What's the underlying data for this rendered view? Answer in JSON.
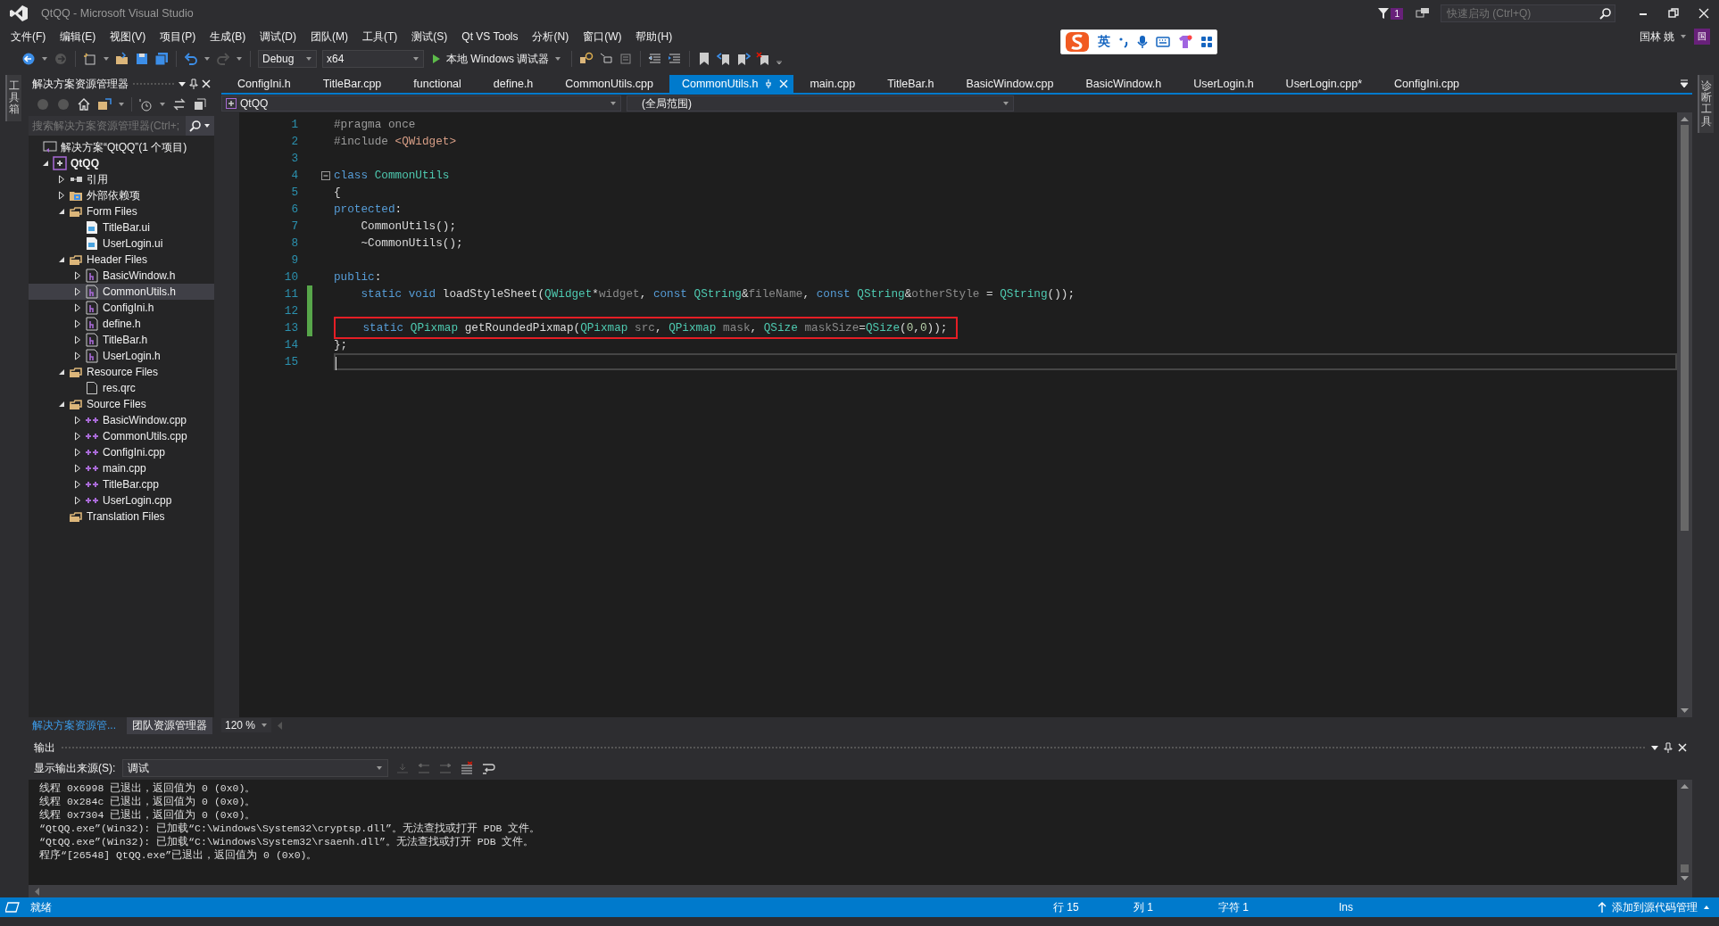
{
  "window": {
    "title": "QtQQ - Microsoft Visual Studio"
  },
  "title_bar": {
    "notification_count": "1",
    "quick_launch": {
      "placeholder": "快速启动 (Ctrl+Q)"
    }
  },
  "menu": [
    "文件(F)",
    "编辑(E)",
    "视图(V)",
    "项目(P)",
    "生成(B)",
    "调试(D)",
    "团队(M)",
    "工具(T)",
    "测试(S)",
    "Qt VS Tools",
    "分析(N)",
    "窗口(W)",
    "帮助(H)"
  ],
  "account": {
    "name": "国林 姚",
    "avatar": "国"
  },
  "ime_bar": {
    "mode": "英"
  },
  "toolbar": {
    "configuration": "Debug",
    "platform": "x64",
    "debugger": "本地 Windows 调试器"
  },
  "side_panels": {
    "left": "工具箱",
    "right": "诊断工具"
  },
  "solution_explorer": {
    "title": "解决方案资源管理器",
    "search": {
      "placeholder": "搜索解决方案资源管理器(Ctrl+;"
    },
    "tree": [
      {
        "label": "解决方案“QtQQ”(1 个项目)",
        "kind": "solution",
        "selected": false,
        "children": [
          {
            "label": "QtQQ",
            "kind": "project",
            "expanded": true,
            "selected": false,
            "children": [
              {
                "label": "引用",
                "kind": "references",
                "expanded": false,
                "selected": false
              },
              {
                "label": "外部依赖项",
                "kind": "external",
                "expanded": false,
                "selected": false
              },
              {
                "label": "Form Files",
                "kind": "folder",
                "expanded": true,
                "selected": false,
                "children": [
                  {
                    "label": "TitleBar.ui",
                    "kind": "ui",
                    "selected": false
                  },
                  {
                    "label": "UserLogin.ui",
                    "kind": "ui",
                    "selected": false
                  }
                ]
              },
              {
                "label": "Header Files",
                "kind": "folder",
                "expanded": true,
                "selected": false,
                "children": [
                  {
                    "label": "BasicWindow.h",
                    "kind": "header",
                    "expanded": false,
                    "selected": false
                  },
                  {
                    "label": "CommonUtils.h",
                    "kind": "header",
                    "expanded": false,
                    "selected": true
                  },
                  {
                    "label": "ConfigIni.h",
                    "kind": "header",
                    "expanded": false,
                    "selected": false
                  },
                  {
                    "label": "define.h",
                    "kind": "header",
                    "expanded": false,
                    "selected": false
                  },
                  {
                    "label": "TitleBar.h",
                    "kind": "header",
                    "expanded": false,
                    "selected": false
                  },
                  {
                    "label": "UserLogin.h",
                    "kind": "header",
                    "expanded": false,
                    "selected": false
                  }
                ]
              },
              {
                "label": "Resource Files",
                "kind": "folder",
                "expanded": true,
                "selected": false,
                "children": [
                  {
                    "label": "res.qrc",
                    "kind": "file",
                    "selected": false
                  }
                ]
              },
              {
                "label": "Source Files",
                "kind": "folder",
                "expanded": true,
                "selected": false,
                "children": [
                  {
                    "label": "BasicWindow.cpp",
                    "kind": "cpp",
                    "expanded": false,
                    "selected": false
                  },
                  {
                    "label": "CommonUtils.cpp",
                    "kind": "cpp",
                    "expanded": false,
                    "selected": false
                  },
                  {
                    "label": "ConfigIni.cpp",
                    "kind": "cpp",
                    "expanded": false,
                    "selected": false
                  },
                  {
                    "label": "main.cpp",
                    "kind": "cpp",
                    "expanded": false,
                    "selected": false
                  },
                  {
                    "label": "TitleBar.cpp",
                    "kind": "cpp",
                    "expanded": false,
                    "selected": false
                  },
                  {
                    "label": "UserLogin.cpp",
                    "kind": "cpp",
                    "expanded": false,
                    "selected": false
                  }
                ]
              },
              {
                "label": "Translation Files",
                "kind": "folder",
                "selected": false
              }
            ]
          }
        ]
      }
    ],
    "bottom_tabs": [
      {
        "label": "解决方案资源管...",
        "selected": true
      },
      {
        "label": "团队资源管理器",
        "selected": false
      }
    ]
  },
  "editor": {
    "tabs": [
      {
        "label": "ConfigIni.h",
        "selected": false
      },
      {
        "label": "TitleBar.cpp",
        "selected": false
      },
      {
        "label": "functional",
        "selected": false
      },
      {
        "label": "define.h",
        "selected": false
      },
      {
        "label": "CommonUtils.cpp",
        "selected": false
      },
      {
        "label": "CommonUtils.h",
        "selected": true
      },
      {
        "label": "main.cpp",
        "selected": false
      },
      {
        "label": "TitleBar.h",
        "selected": false
      },
      {
        "label": "BasicWindow.cpp",
        "selected": false
      },
      {
        "label": "BasicWindow.h",
        "selected": false
      },
      {
        "label": "UserLogin.h",
        "selected": false
      },
      {
        "label": "UserLogin.cpp*",
        "selected": false
      },
      {
        "label": "ConfigIni.cpp",
        "selected": false
      }
    ],
    "navigation": {
      "project": "QtQQ",
      "scope": "(全局范围)"
    },
    "zoom": "120 %",
    "lines": [
      {
        "number": "1",
        "changed": false,
        "current": false,
        "highlighted": false,
        "tokens": [
          {
            "kind": "preprocessor",
            "text": "#pragma once"
          }
        ]
      },
      {
        "number": "2",
        "changed": false,
        "current": false,
        "highlighted": false,
        "tokens": [
          {
            "kind": "preprocessor",
            "text": "#include "
          },
          {
            "kind": "include",
            "text": "<QWidget>"
          }
        ]
      },
      {
        "number": "3",
        "changed": false,
        "current": false,
        "highlighted": false
      },
      {
        "number": "4",
        "changed": false,
        "current": false,
        "highlighted": false,
        "expanded": true,
        "tokens": [
          {
            "kind": "keyword",
            "text": "class "
          },
          {
            "kind": "type",
            "text": "CommonUtils"
          }
        ]
      },
      {
        "number": "5",
        "changed": false,
        "current": false,
        "highlighted": false,
        "tokens": [
          {
            "kind": "plain",
            "text": "{"
          }
        ]
      },
      {
        "number": "6",
        "changed": false,
        "current": false,
        "highlighted": false,
        "tokens": [
          {
            "kind": "keyword",
            "text": "protected"
          },
          {
            "kind": "plain",
            "text": ":"
          }
        ]
      },
      {
        "number": "7",
        "changed": false,
        "current": false,
        "highlighted": false,
        "tokens": [
          {
            "kind": "plain",
            "text": "    CommonUtils();"
          }
        ]
      },
      {
        "number": "8",
        "changed": false,
        "current": false,
        "highlighted": false,
        "tokens": [
          {
            "kind": "plain",
            "text": "    ~CommonUtils();"
          }
        ]
      },
      {
        "number": "9",
        "changed": false,
        "current": false,
        "highlighted": false
      },
      {
        "number": "10",
        "changed": false,
        "current": false,
        "highlighted": false,
        "tokens": [
          {
            "kind": "keyword",
            "text": "public"
          },
          {
            "kind": "plain",
            "text": ":"
          }
        ]
      },
      {
        "number": "11",
        "changed": true,
        "current": false,
        "highlighted": false,
        "tokens": [
          {
            "kind": "keyword",
            "text": "    static void "
          },
          {
            "kind": "plain",
            "text": "loadStyleSheet("
          },
          {
            "kind": "type",
            "text": "QWidget"
          },
          {
            "kind": "plain",
            "text": "*"
          },
          {
            "kind": "parameter",
            "text": "widget"
          },
          {
            "kind": "plain",
            "text": ", "
          },
          {
            "kind": "keyword",
            "text": "const "
          },
          {
            "kind": "type",
            "text": "QString"
          },
          {
            "kind": "plain",
            "text": "&"
          },
          {
            "kind": "parameter",
            "text": "fileName"
          },
          {
            "kind": "plain",
            "text": ", "
          },
          {
            "kind": "keyword",
            "text": "const "
          },
          {
            "kind": "type",
            "text": "QString"
          },
          {
            "kind": "plain",
            "text": "&"
          },
          {
            "kind": "parameter",
            "text": "otherStyle"
          },
          {
            "kind": "plain",
            "text": " = "
          },
          {
            "kind": "type",
            "text": "QString"
          },
          {
            "kind": "plain",
            "text": "());"
          }
        ]
      },
      {
        "number": "12",
        "changed": true,
        "current": false,
        "highlighted": false
      },
      {
        "number": "13",
        "changed": true,
        "current": false,
        "highlighted": true,
        "tokens": [
          {
            "kind": "keyword",
            "text": "    static "
          },
          {
            "kind": "type",
            "text": "QPixmap"
          },
          {
            "kind": "plain",
            "text": " getRoundedPixmap("
          },
          {
            "kind": "type",
            "text": "QPixmap"
          },
          {
            "kind": "parameter",
            "text": " src"
          },
          {
            "kind": "plain",
            "text": ", "
          },
          {
            "kind": "type",
            "text": "QPixmap"
          },
          {
            "kind": "parameter",
            "text": " mask"
          },
          {
            "kind": "plain",
            "text": ", "
          },
          {
            "kind": "type",
            "text": "QSize"
          },
          {
            "kind": "parameter",
            "text": " maskSize"
          },
          {
            "kind": "plain",
            "text": "="
          },
          {
            "kind": "type",
            "text": "QSize"
          },
          {
            "kind": "plain",
            "text": "("
          },
          {
            "kind": "number",
            "text": "0"
          },
          {
            "kind": "plain",
            "text": ","
          },
          {
            "kind": "number",
            "text": "0"
          },
          {
            "kind": "plain",
            "text": "));"
          }
        ]
      },
      {
        "number": "14",
        "changed": false,
        "current": false,
        "highlighted": false,
        "tokens": [
          {
            "kind": "plain",
            "text": "};"
          }
        ]
      },
      {
        "number": "15",
        "changed": false,
        "current": true,
        "highlighted": false
      }
    ]
  },
  "output": {
    "title": "输出",
    "source_label": "显示输出来源(S):",
    "source": "调试",
    "lines": [
      "线程 0x6998 已退出，返回值为 0 (0x0)。",
      "线程 0x284c 已退出，返回值为 0 (0x0)。",
      "线程 0x7304 已退出，返回值为 0 (0x0)。",
      "“QtQQ.exe”(Win32): 已加载“C:\\Windows\\System32\\cryptsp.dll”。无法查找或打开 PDB 文件。",
      "“QtQQ.exe”(Win32): 已加载“C:\\Windows\\System32\\rsaenh.dll”。无法查找或打开 PDB 文件。",
      "程序“[26548] QtQQ.exe”已退出，返回值为 0 (0x0)。"
    ]
  },
  "status_bar": {
    "message": "就绪",
    "line": "行 15",
    "column": "列 1",
    "character": "字符 1",
    "mode": "Ins",
    "source_control": "添加到源代码管理"
  }
}
